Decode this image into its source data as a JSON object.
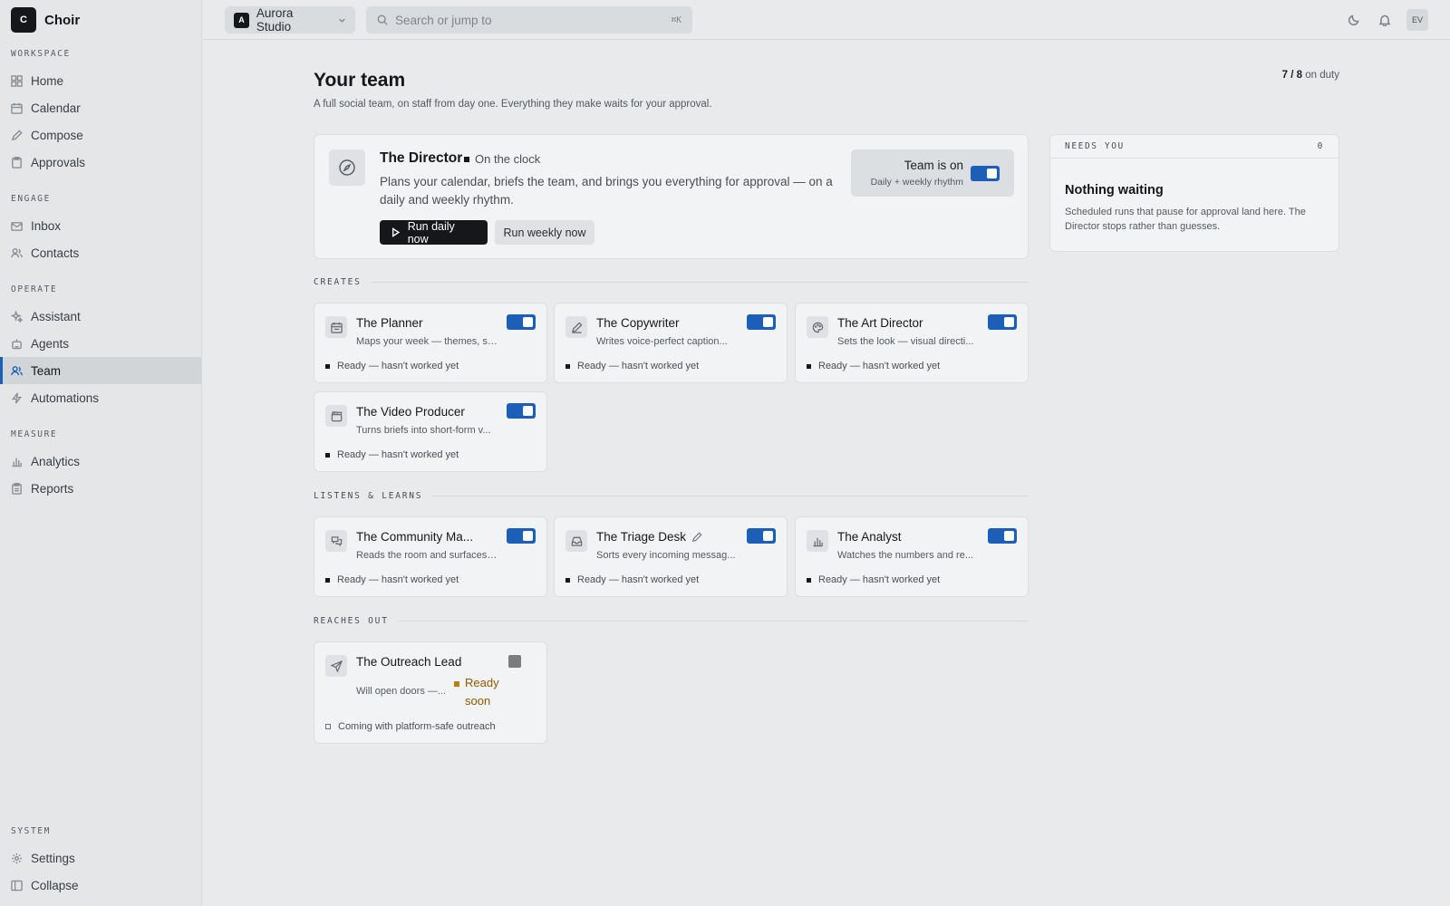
{
  "app": {
    "logo_letter": "C",
    "name": "Choir"
  },
  "sidebar": {
    "sections": [
      {
        "label": "WORKSPACE",
        "items": [
          "Home",
          "Calendar",
          "Compose",
          "Approvals"
        ]
      },
      {
        "label": "ENGAGE",
        "items": [
          "Inbox",
          "Contacts"
        ]
      },
      {
        "label": "OPERATE",
        "items": [
          "Assistant",
          "Agents",
          "Team",
          "Automations"
        ]
      },
      {
        "label": "MEASURE",
        "items": [
          "Analytics",
          "Reports"
        ]
      }
    ],
    "active": "Team",
    "system": {
      "label": "SYSTEM",
      "settings": "Settings",
      "collapse": "Collapse"
    }
  },
  "topbar": {
    "workspace_badge": "A",
    "workspace_name": "Aurora Studio",
    "search_placeholder": "Search or jump to",
    "search_shortcut": "⌘K",
    "avatar_initials": "EV"
  },
  "page": {
    "title": "Your team",
    "subtitle": "A full social team, on staff from day one. Everything they make waits for your approval.",
    "on_duty_count": "7 / 8",
    "on_duty_label": "on duty"
  },
  "director": {
    "name": "The Director",
    "status": "On the clock",
    "description": "Plans your calendar, briefs the team, and brings you everything for approval — on a daily and weekly rhythm.",
    "run_daily": "Run daily now",
    "run_weekly": "Run weekly now",
    "team_on_title": "Team is on",
    "team_on_sub": "Daily + weekly rhythm"
  },
  "needs_you": {
    "label": "NEEDS YOU",
    "count": "0",
    "title": "Nothing waiting",
    "text": "Scheduled runs that pause for approval land here. The Director stops rather than guesses."
  },
  "sections": {
    "creates": "CREATES",
    "listens": "LISTENS & LEARNS",
    "reaches": "REACHES OUT"
  },
  "agents": {
    "planner": {
      "name": "The Planner",
      "desc": "Maps your week — themes, sl...",
      "status": "Ready — hasn't worked yet"
    },
    "copywriter": {
      "name": "The Copywriter",
      "desc": "Writes voice-perfect caption...",
      "status": "Ready — hasn't worked yet"
    },
    "art_director": {
      "name": "The Art Director",
      "desc": "Sets the look — visual directi...",
      "status": "Ready — hasn't worked yet"
    },
    "video_producer": {
      "name": "The Video Producer",
      "desc": "Turns briefs into short-form v...",
      "status": "Ready — hasn't worked yet"
    },
    "community": {
      "name": "The Community Ma...",
      "desc": "Reads the room and surfaces ...",
      "status": "Ready — hasn't worked yet"
    },
    "triage": {
      "name": "The Triage Desk",
      "desc": "Sorts every incoming messag...",
      "status": "Ready — hasn't worked yet"
    },
    "analyst": {
      "name": "The Analyst",
      "desc": "Watches the numbers and re...",
      "status": "Ready — hasn't worked yet"
    },
    "outreach": {
      "name": "The Outreach Lead",
      "desc": "Will open doors —...",
      "badge_line1": "Ready",
      "badge_line2": "soon",
      "status": "Coming with platform-safe outreach"
    }
  }
}
